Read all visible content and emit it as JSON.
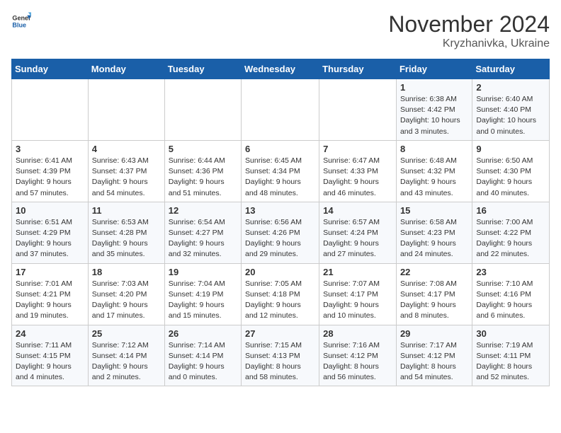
{
  "header": {
    "logo_general": "General",
    "logo_blue": "Blue",
    "month_year": "November 2024",
    "location": "Kryzhanivka, Ukraine"
  },
  "days_of_week": [
    "Sunday",
    "Monday",
    "Tuesday",
    "Wednesday",
    "Thursday",
    "Friday",
    "Saturday"
  ],
  "weeks": [
    [
      {
        "day": "",
        "info": ""
      },
      {
        "day": "",
        "info": ""
      },
      {
        "day": "",
        "info": ""
      },
      {
        "day": "",
        "info": ""
      },
      {
        "day": "",
        "info": ""
      },
      {
        "day": "1",
        "info": "Sunrise: 6:38 AM\nSunset: 4:42 PM\nDaylight: 10 hours\nand 3 minutes."
      },
      {
        "day": "2",
        "info": "Sunrise: 6:40 AM\nSunset: 4:40 PM\nDaylight: 10 hours\nand 0 minutes."
      }
    ],
    [
      {
        "day": "3",
        "info": "Sunrise: 6:41 AM\nSunset: 4:39 PM\nDaylight: 9 hours\nand 57 minutes."
      },
      {
        "day": "4",
        "info": "Sunrise: 6:43 AM\nSunset: 4:37 PM\nDaylight: 9 hours\nand 54 minutes."
      },
      {
        "day": "5",
        "info": "Sunrise: 6:44 AM\nSunset: 4:36 PM\nDaylight: 9 hours\nand 51 minutes."
      },
      {
        "day": "6",
        "info": "Sunrise: 6:45 AM\nSunset: 4:34 PM\nDaylight: 9 hours\nand 48 minutes."
      },
      {
        "day": "7",
        "info": "Sunrise: 6:47 AM\nSunset: 4:33 PM\nDaylight: 9 hours\nand 46 minutes."
      },
      {
        "day": "8",
        "info": "Sunrise: 6:48 AM\nSunset: 4:32 PM\nDaylight: 9 hours\nand 43 minutes."
      },
      {
        "day": "9",
        "info": "Sunrise: 6:50 AM\nSunset: 4:30 PM\nDaylight: 9 hours\nand 40 minutes."
      }
    ],
    [
      {
        "day": "10",
        "info": "Sunrise: 6:51 AM\nSunset: 4:29 PM\nDaylight: 9 hours\nand 37 minutes."
      },
      {
        "day": "11",
        "info": "Sunrise: 6:53 AM\nSunset: 4:28 PM\nDaylight: 9 hours\nand 35 minutes."
      },
      {
        "day": "12",
        "info": "Sunrise: 6:54 AM\nSunset: 4:27 PM\nDaylight: 9 hours\nand 32 minutes."
      },
      {
        "day": "13",
        "info": "Sunrise: 6:56 AM\nSunset: 4:26 PM\nDaylight: 9 hours\nand 29 minutes."
      },
      {
        "day": "14",
        "info": "Sunrise: 6:57 AM\nSunset: 4:24 PM\nDaylight: 9 hours\nand 27 minutes."
      },
      {
        "day": "15",
        "info": "Sunrise: 6:58 AM\nSunset: 4:23 PM\nDaylight: 9 hours\nand 24 minutes."
      },
      {
        "day": "16",
        "info": "Sunrise: 7:00 AM\nSunset: 4:22 PM\nDaylight: 9 hours\nand 22 minutes."
      }
    ],
    [
      {
        "day": "17",
        "info": "Sunrise: 7:01 AM\nSunset: 4:21 PM\nDaylight: 9 hours\nand 19 minutes."
      },
      {
        "day": "18",
        "info": "Sunrise: 7:03 AM\nSunset: 4:20 PM\nDaylight: 9 hours\nand 17 minutes."
      },
      {
        "day": "19",
        "info": "Sunrise: 7:04 AM\nSunset: 4:19 PM\nDaylight: 9 hours\nand 15 minutes."
      },
      {
        "day": "20",
        "info": "Sunrise: 7:05 AM\nSunset: 4:18 PM\nDaylight: 9 hours\nand 12 minutes."
      },
      {
        "day": "21",
        "info": "Sunrise: 7:07 AM\nSunset: 4:17 PM\nDaylight: 9 hours\nand 10 minutes."
      },
      {
        "day": "22",
        "info": "Sunrise: 7:08 AM\nSunset: 4:17 PM\nDaylight: 9 hours\nand 8 minutes."
      },
      {
        "day": "23",
        "info": "Sunrise: 7:10 AM\nSunset: 4:16 PM\nDaylight: 9 hours\nand 6 minutes."
      }
    ],
    [
      {
        "day": "24",
        "info": "Sunrise: 7:11 AM\nSunset: 4:15 PM\nDaylight: 9 hours\nand 4 minutes."
      },
      {
        "day": "25",
        "info": "Sunrise: 7:12 AM\nSunset: 4:14 PM\nDaylight: 9 hours\nand 2 minutes."
      },
      {
        "day": "26",
        "info": "Sunrise: 7:14 AM\nSunset: 4:14 PM\nDaylight: 9 hours\nand 0 minutes."
      },
      {
        "day": "27",
        "info": "Sunrise: 7:15 AM\nSunset: 4:13 PM\nDaylight: 8 hours\nand 58 minutes."
      },
      {
        "day": "28",
        "info": "Sunrise: 7:16 AM\nSunset: 4:12 PM\nDaylight: 8 hours\nand 56 minutes."
      },
      {
        "day": "29",
        "info": "Sunrise: 7:17 AM\nSunset: 4:12 PM\nDaylight: 8 hours\nand 54 minutes."
      },
      {
        "day": "30",
        "info": "Sunrise: 7:19 AM\nSunset: 4:11 PM\nDaylight: 8 hours\nand 52 minutes."
      }
    ]
  ]
}
